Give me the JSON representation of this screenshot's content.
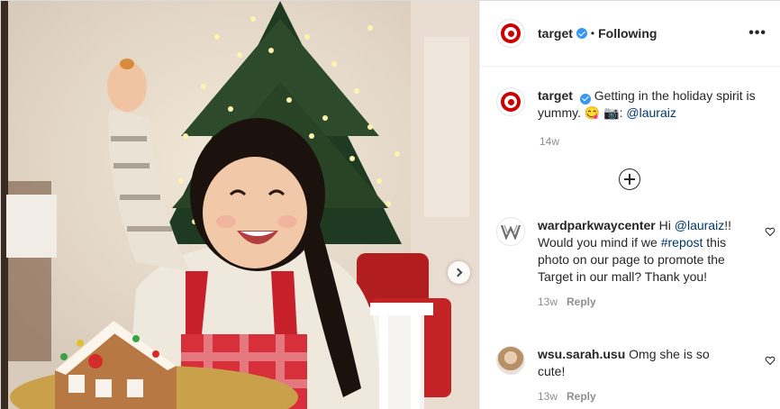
{
  "post": {
    "account": "target",
    "follow_status": "Following",
    "more_label": "•••",
    "next_icon": "chevron-right-icon"
  },
  "caption": {
    "username": "target",
    "text_before": "Getting in the holiday spirit is yummy. 😋 📷: ",
    "mention": "@lauraiz",
    "time": "14w"
  },
  "load_more_icon": "plus-circle-icon",
  "comments": [
    {
      "username": "wardparkwaycenter",
      "text_before": "Hi ",
      "mention": "@lauraiz",
      "text_mid": "!! Would you mind if we ",
      "hashtag": "#repost",
      "text_after": " this photo on our page to promote the Target in our mall? Thank you!",
      "time": "13w",
      "reply": "Reply"
    },
    {
      "username": "wsu.sarah.usu",
      "text": "Omg she is so cute!",
      "time": "13w",
      "reply": "Reply"
    }
  ],
  "colors": {
    "accent_blue": "#3897f0",
    "target_red": "#cc0000",
    "link": "#00376b",
    "muted": "#8e8e8e"
  }
}
